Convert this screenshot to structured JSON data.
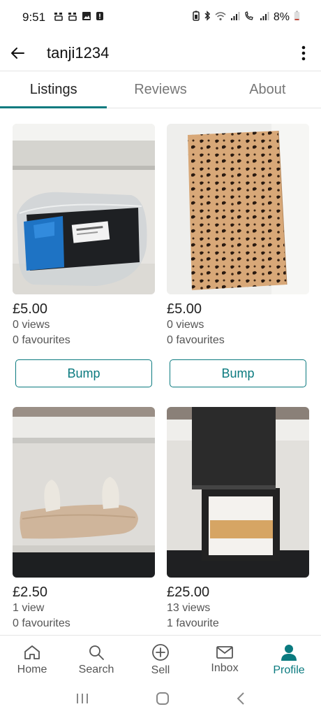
{
  "status_bar": {
    "time": "9:51",
    "battery": "8%"
  },
  "app_bar": {
    "title": "tanji1234"
  },
  "tabs": [
    {
      "label": "Listings",
      "active": true
    },
    {
      "label": "Reviews",
      "active": false
    },
    {
      "label": "About",
      "active": false
    }
  ],
  "listings": [
    {
      "price": "£5.00",
      "views": "0 views",
      "favourites": "0 favourites",
      "button": "Bump",
      "image": "packaged-blue-black-item"
    },
    {
      "price": "£5.00",
      "views": "0 views",
      "favourites": "0 favourites",
      "button": "Bump",
      "image": "leopard-print-skirt"
    },
    {
      "price": "£2.50",
      "views": "1 view",
      "favourites": "0 favourites",
      "image": "fluffy-ear-headband"
    },
    {
      "price": "£25.00",
      "views": "13 views",
      "favourites": "1 favourite",
      "image": "lucrin-box"
    }
  ],
  "bottom_nav": [
    {
      "label": "Home",
      "icon": "home-icon",
      "active": false
    },
    {
      "label": "Search",
      "icon": "search-icon",
      "active": false
    },
    {
      "label": "Sell",
      "icon": "plus-circle-icon",
      "active": false
    },
    {
      "label": "Inbox",
      "icon": "mail-icon",
      "active": false
    },
    {
      "label": "Profile",
      "icon": "person-icon",
      "active": true
    }
  ],
  "colors": {
    "accent": "#0a7a7f"
  }
}
